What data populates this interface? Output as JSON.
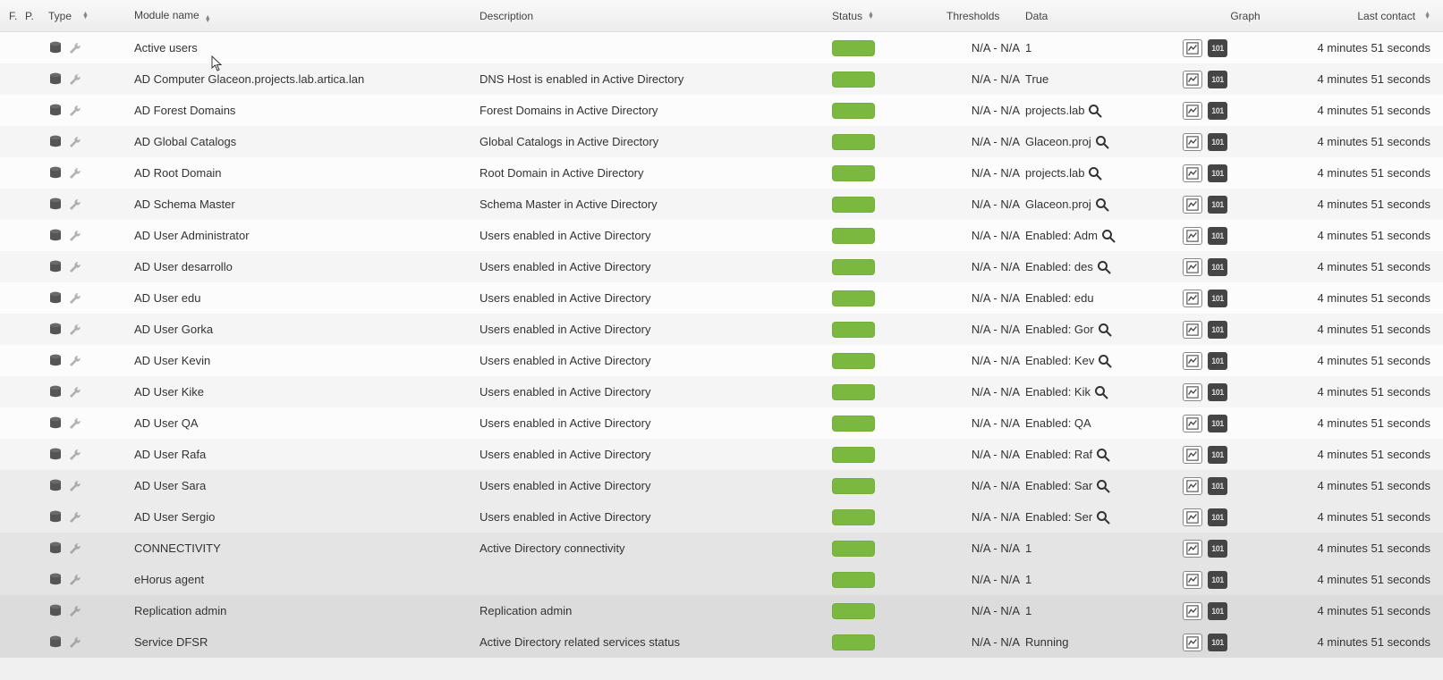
{
  "headers": {
    "f": "F.",
    "p": "P.",
    "type": "Type",
    "module_name": "Module name",
    "description": "Description",
    "status": "Status",
    "thresholds": "Thresholds",
    "data": "Data",
    "graph": "Graph",
    "last_contact": "Last contact"
  },
  "thresholds_value": "N/A - N/A",
  "last_contact_value": "4 minutes 51 seconds",
  "rows": [
    {
      "name": "Active users",
      "desc": "",
      "data": "1",
      "mag": false,
      "shade": ""
    },
    {
      "name": "AD Computer Glaceon.projects.lab.artica.lan",
      "desc": "DNS Host is enabled in Active Directory",
      "data": "True",
      "mag": false,
      "shade": ""
    },
    {
      "name": "AD Forest Domains",
      "desc": "Forest Domains in Active Directory",
      "data": "projects.lab",
      "mag": true,
      "shade": ""
    },
    {
      "name": "AD Global Catalogs",
      "desc": "Global Catalogs in Active Directory",
      "data": "Glaceon.proj",
      "mag": true,
      "shade": ""
    },
    {
      "name": "AD Root Domain",
      "desc": "Root Domain in Active Directory",
      "data": "projects.lab",
      "mag": true,
      "shade": ""
    },
    {
      "name": "AD Schema Master",
      "desc": "Schema Master in Active Directory",
      "data": "Glaceon.proj",
      "mag": true,
      "shade": ""
    },
    {
      "name": "AD User Administrator",
      "desc": "Users enabled in Active Directory",
      "data": "Enabled: Adm",
      "mag": true,
      "shade": ""
    },
    {
      "name": "AD User desarrollo",
      "desc": "Users enabled in Active Directory",
      "data": "Enabled: des",
      "mag": true,
      "shade": ""
    },
    {
      "name": "AD User edu",
      "desc": "Users enabled in Active Directory",
      "data": "Enabled: edu",
      "mag": false,
      "shade": ""
    },
    {
      "name": "AD User Gorka",
      "desc": "Users enabled in Active Directory",
      "data": "Enabled: Gor",
      "mag": true,
      "shade": ""
    },
    {
      "name": "AD User Kevin",
      "desc": "Users enabled in Active Directory",
      "data": "Enabled: Kev",
      "mag": true,
      "shade": ""
    },
    {
      "name": "AD User Kike",
      "desc": "Users enabled in Active Directory",
      "data": "Enabled: Kik",
      "mag": true,
      "shade": ""
    },
    {
      "name": "AD User QA",
      "desc": "Users enabled in Active Directory",
      "data": "Enabled: QA",
      "mag": false,
      "shade": ""
    },
    {
      "name": "AD User Rafa",
      "desc": "Users enabled in Active Directory",
      "data": "Enabled: Raf",
      "mag": true,
      "shade": ""
    },
    {
      "name": "AD User Sara",
      "desc": "Users enabled in Active Directory",
      "data": "Enabled: Sar",
      "mag": true,
      "shade": "shade1"
    },
    {
      "name": "AD User Sergio",
      "desc": "Users enabled in Active Directory",
      "data": "Enabled: Ser",
      "mag": true,
      "shade": "shade1"
    },
    {
      "name": "CONNECTIVITY",
      "desc": "Active Directory connectivity",
      "data": "1",
      "mag": false,
      "shade": "shade2"
    },
    {
      "name": "eHorus agent",
      "desc": "",
      "data": "1",
      "mag": false,
      "shade": "shade2"
    },
    {
      "name": "Replication admin",
      "desc": "Replication admin",
      "data": "1",
      "mag": false,
      "shade": "shade3"
    },
    {
      "name": "Service DFSR",
      "desc": "Active Directory related services status",
      "data": "Running",
      "mag": false,
      "shade": "shade3"
    }
  ]
}
